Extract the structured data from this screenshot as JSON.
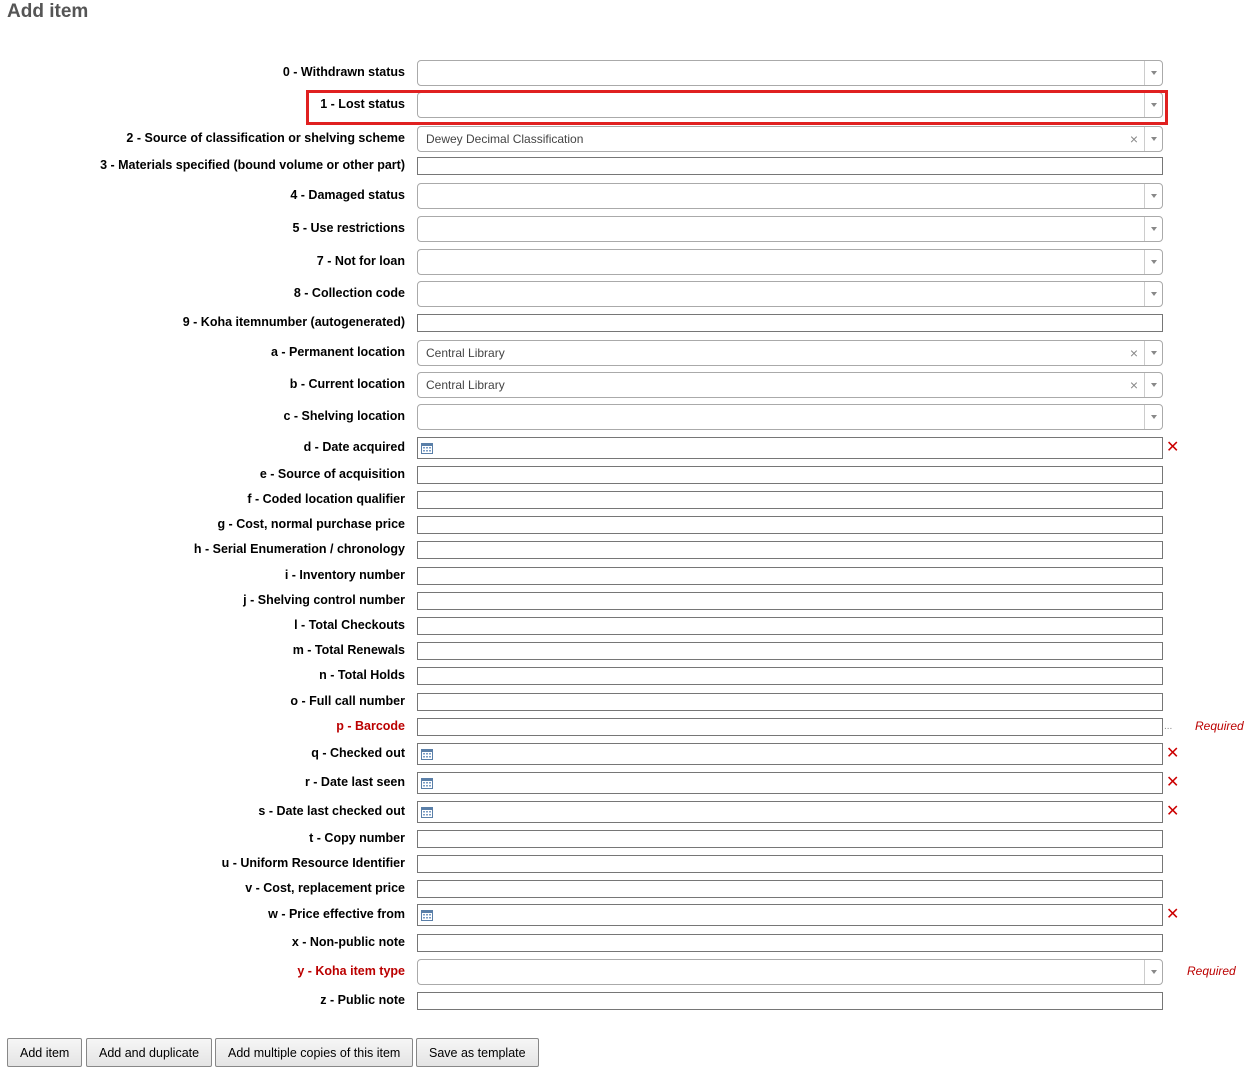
{
  "page": {
    "title": "Add item"
  },
  "fields": [
    {
      "label": "0 - Withdrawn status",
      "type": "select",
      "value": ""
    },
    {
      "label": "1 - Lost status",
      "type": "select",
      "value": ""
    },
    {
      "label": "2 - Source of classification or shelving scheme",
      "type": "select",
      "value": "Dewey Decimal Classification"
    },
    {
      "label": "3 - Materials specified (bound volume or other part)",
      "type": "text",
      "value": ""
    },
    {
      "label": "4 - Damaged status",
      "type": "select",
      "value": ""
    },
    {
      "label": "5 - Use restrictions",
      "type": "select",
      "value": ""
    },
    {
      "label": "7 - Not for loan",
      "type": "select",
      "value": ""
    },
    {
      "label": "8 - Collection code",
      "type": "select",
      "value": ""
    },
    {
      "label": "9 - Koha itemnumber (autogenerated)",
      "type": "text",
      "value": ""
    },
    {
      "label": "a - Permanent location",
      "type": "select",
      "value": "Central Library"
    },
    {
      "label": "b - Current location",
      "type": "select",
      "value": "Central Library"
    },
    {
      "label": "c - Shelving location",
      "type": "select",
      "value": ""
    },
    {
      "label": "d - Date acquired",
      "type": "date",
      "value": ""
    },
    {
      "label": "e - Source of acquisition",
      "type": "text",
      "value": ""
    },
    {
      "label": "f - Coded location qualifier",
      "type": "text",
      "value": ""
    },
    {
      "label": "g - Cost, normal purchase price",
      "type": "text",
      "value": ""
    },
    {
      "label": "h - Serial Enumeration / chronology",
      "type": "text",
      "value": ""
    },
    {
      "label": "i - Inventory number",
      "type": "text",
      "value": ""
    },
    {
      "label": "j - Shelving control number",
      "type": "text",
      "value": ""
    },
    {
      "label": "l - Total Checkouts",
      "type": "text",
      "value": ""
    },
    {
      "label": "m - Total Renewals",
      "type": "text",
      "value": ""
    },
    {
      "label": "n - Total Holds",
      "type": "text",
      "value": ""
    },
    {
      "label": "o - Full call number",
      "type": "text",
      "value": ""
    },
    {
      "label": "p - Barcode",
      "type": "text",
      "value": "",
      "required": true,
      "note": "Required"
    },
    {
      "label": "q - Checked out",
      "type": "date",
      "value": ""
    },
    {
      "label": "r - Date last seen",
      "type": "date",
      "value": ""
    },
    {
      "label": "s - Date last checked out",
      "type": "date",
      "value": ""
    },
    {
      "label": "t - Copy number",
      "type": "text",
      "value": ""
    },
    {
      "label": "u - Uniform Resource Identifier",
      "type": "text",
      "value": ""
    },
    {
      "label": "v - Cost, replacement price",
      "type": "text",
      "value": ""
    },
    {
      "label": "w - Price effective from",
      "type": "date",
      "value": ""
    },
    {
      "label": "x - Non-public note",
      "type": "text",
      "value": ""
    },
    {
      "label": "y - Koha item type",
      "type": "select",
      "value": "",
      "required": true,
      "note": "Required"
    },
    {
      "label": "z - Public note",
      "type": "text",
      "value": ""
    }
  ],
  "buttons": {
    "add_item": "Add item",
    "add_and_duplicate": "Add and duplicate",
    "add_multiple": "Add multiple copies of this item",
    "save_template": "Save as template"
  },
  "icons": {
    "calendar": "calendar-icon",
    "clear": "clear-date-icon",
    "dropdown": "chevron-down-icon"
  },
  "colors": {
    "required": "#bb0000",
    "highlight": "#e02020",
    "clear": "#cc0000"
  }
}
